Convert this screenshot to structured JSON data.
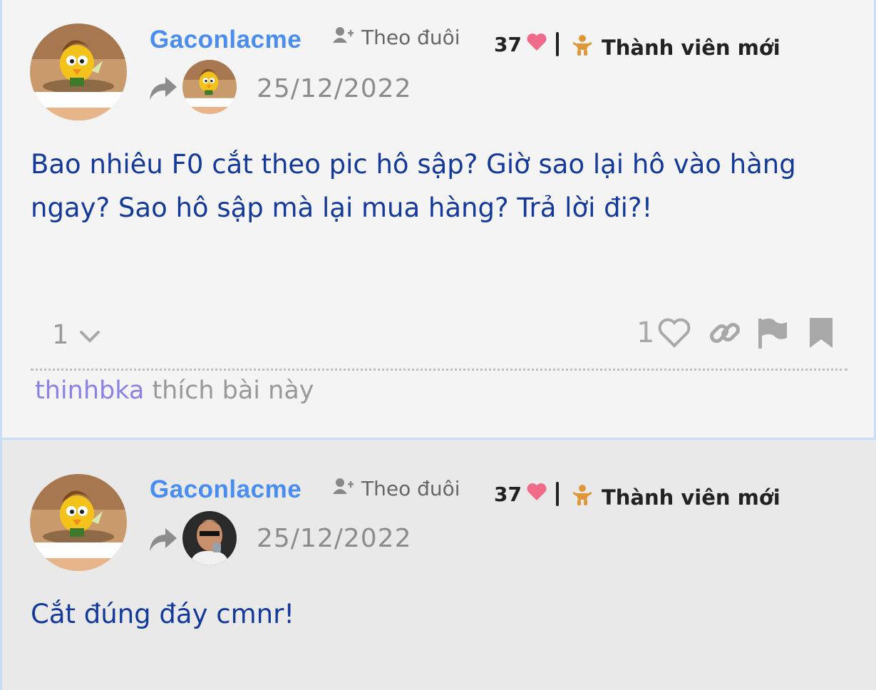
{
  "posts": [
    {
      "username": "Gaconlacme",
      "follow_label": "Theo đuôi",
      "likes_received": "37",
      "rank": "Thành viên mới",
      "date": "25/12/2022",
      "content": "Bao nhiêu F0 cắt theo pic hô sập? Giờ sao lại hô vào hàng ngay? Sao hô sập mà lại mua hàng? Trả lời đi?!",
      "reply_count": "1",
      "like_count": "1",
      "liked_by_user": "thinhbka",
      "liked_by_suffix": " thích bài này"
    },
    {
      "username": "Gaconlacme",
      "follow_label": "Theo đuôi",
      "likes_received": "37",
      "rank": "Thành viên mới",
      "date": "25/12/2022",
      "content": "Cắt đúng đáy cmnr!"
    }
  ],
  "icons": {
    "follow": "user-plus-icon",
    "like": "heart-icon",
    "rank": "baby-icon",
    "reply_to": "share-arrow-icon",
    "expand": "chevron-down-icon",
    "link": "link-icon",
    "flag": "flag-icon",
    "bookmark": "bookmark-icon"
  },
  "colors": {
    "username": "#4a8df0",
    "content": "#13399a",
    "heart": "#f06a8a",
    "rank_icon": "#e0973a",
    "liker": "#8a83e6",
    "post1_bg": "#f4f4f4",
    "post2_bg": "#e9e9e9"
  }
}
